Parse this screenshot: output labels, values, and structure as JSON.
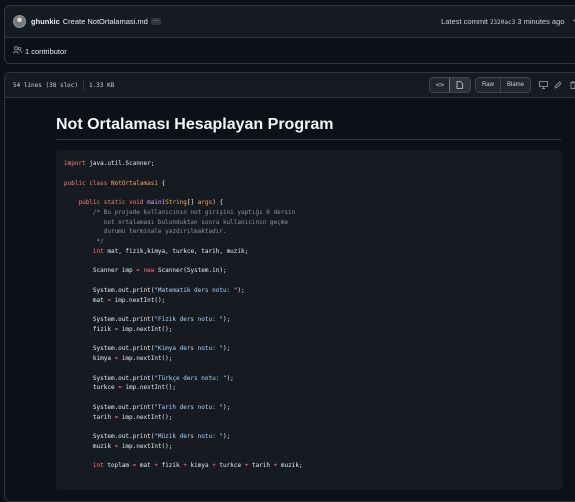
{
  "commit": {
    "author": "ghunkic",
    "message": "Create NotOrtalamasi.md",
    "ellipsis": "…",
    "latest_prefix": "Latest commit",
    "sha": "2320ac3",
    "time_ago": "3 minutes ago",
    "contributors": "1 contributor"
  },
  "file": {
    "lines_info": "54 lines (38 sloc)",
    "size": "1.33 KB",
    "code_view_icon": "<>",
    "preview_icon": "▯",
    "raw_label": "Raw",
    "blame_label": "Blame"
  },
  "markdown": {
    "title": "Not Ortalaması Hesaplayan Program"
  },
  "code": [
    [
      {
        "t": "import",
        "c": "kw"
      },
      {
        "t": " java.util.Scanner;",
        "c": "pl"
      }
    ],
    [],
    [
      {
        "t": "public",
        "c": "kw"
      },
      {
        "t": " ",
        "c": "pl"
      },
      {
        "t": "class",
        "c": "kw"
      },
      {
        "t": " ",
        "c": "pl"
      },
      {
        "t": "NotOrtalamasi",
        "c": "ty"
      },
      {
        "t": " {",
        "c": "pl"
      }
    ],
    [],
    [
      {
        "t": "    ",
        "c": "pl"
      },
      {
        "t": "public",
        "c": "kw"
      },
      {
        "t": " ",
        "c": "pl"
      },
      {
        "t": "static",
        "c": "kw"
      },
      {
        "t": " ",
        "c": "pl"
      },
      {
        "t": "void",
        "c": "kw"
      },
      {
        "t": " ",
        "c": "pl"
      },
      {
        "t": "main",
        "c": "fn"
      },
      {
        "t": "(",
        "c": "pl"
      },
      {
        "t": "String",
        "c": "ty"
      },
      {
        "t": "[] ",
        "c": "pl"
      },
      {
        "t": "args",
        "c": "ty"
      },
      {
        "t": ") {",
        "c": "pl"
      }
    ],
    [
      {
        "t": "        /* Bu projede kullanıcının not girişini yaptığı 6 dersin",
        "c": "cm"
      }
    ],
    [
      {
        "t": "           not ortalaması bulunduktan sonra kullanıcının geçme",
        "c": "cm"
      }
    ],
    [
      {
        "t": "           durumu terminale yazdırılmaktadır.",
        "c": "cm"
      }
    ],
    [
      {
        "t": "         */",
        "c": "cm"
      }
    ],
    [
      {
        "t": "        ",
        "c": "pl"
      },
      {
        "t": "int",
        "c": "kw"
      },
      {
        "t": " mat, fizik,kimya, turkce, tarih, muzik;",
        "c": "pl"
      }
    ],
    [],
    [
      {
        "t": "        Scanner imp ",
        "c": "pl"
      },
      {
        "t": "=",
        "c": "op"
      },
      {
        "t": " ",
        "c": "pl"
      },
      {
        "t": "new",
        "c": "kw"
      },
      {
        "t": " Scanner(System.in);",
        "c": "pl"
      }
    ],
    [],
    [
      {
        "t": "        System.out.print(",
        "c": "pl"
      },
      {
        "t": "\"Matematik ders notu: \"",
        "c": "str"
      },
      {
        "t": ");",
        "c": "pl"
      }
    ],
    [
      {
        "t": "        mat ",
        "c": "pl"
      },
      {
        "t": "=",
        "c": "op"
      },
      {
        "t": " imp.nextInt();",
        "c": "pl"
      }
    ],
    [],
    [
      {
        "t": "        System.out.print(",
        "c": "pl"
      },
      {
        "t": "\"Fizik ders notu: \"",
        "c": "str"
      },
      {
        "t": ");",
        "c": "pl"
      }
    ],
    [
      {
        "t": "        fizik ",
        "c": "pl"
      },
      {
        "t": "=",
        "c": "op"
      },
      {
        "t": " imp.nextInt();",
        "c": "pl"
      }
    ],
    [],
    [
      {
        "t": "        System.out.print(",
        "c": "pl"
      },
      {
        "t": "\"Kimya ders notu: \"",
        "c": "str"
      },
      {
        "t": ");",
        "c": "pl"
      }
    ],
    [
      {
        "t": "        kimya ",
        "c": "pl"
      },
      {
        "t": "=",
        "c": "op"
      },
      {
        "t": " imp.nextInt();",
        "c": "pl"
      }
    ],
    [],
    [
      {
        "t": "        System.out.print(",
        "c": "pl"
      },
      {
        "t": "\"Türkçe ders notu: \"",
        "c": "str"
      },
      {
        "t": ");",
        "c": "pl"
      }
    ],
    [
      {
        "t": "        turkce ",
        "c": "pl"
      },
      {
        "t": "=",
        "c": "op"
      },
      {
        "t": " imp.nextInt();",
        "c": "pl"
      }
    ],
    [],
    [
      {
        "t": "        System.out.print(",
        "c": "pl"
      },
      {
        "t": "\"Tarih ders notu: \"",
        "c": "str"
      },
      {
        "t": ");",
        "c": "pl"
      }
    ],
    [
      {
        "t": "        tarih ",
        "c": "pl"
      },
      {
        "t": "=",
        "c": "op"
      },
      {
        "t": " imp.nextInt();",
        "c": "pl"
      }
    ],
    [],
    [
      {
        "t": "        System.out.print(",
        "c": "pl"
      },
      {
        "t": "\"Müzik ders notu: \"",
        "c": "str"
      },
      {
        "t": ");",
        "c": "pl"
      }
    ],
    [
      {
        "t": "        muzik ",
        "c": "pl"
      },
      {
        "t": "=",
        "c": "op"
      },
      {
        "t": " imp.nextInt();",
        "c": "pl"
      }
    ],
    [],
    [
      {
        "t": "        ",
        "c": "pl"
      },
      {
        "t": "int",
        "c": "kw"
      },
      {
        "t": " toplam ",
        "c": "pl"
      },
      {
        "t": "=",
        "c": "op"
      },
      {
        "t": " mat ",
        "c": "pl"
      },
      {
        "t": "+",
        "c": "op"
      },
      {
        "t": " fizik ",
        "c": "pl"
      },
      {
        "t": "+",
        "c": "op"
      },
      {
        "t": " kimya ",
        "c": "pl"
      },
      {
        "t": "+",
        "c": "op"
      },
      {
        "t": " turkce ",
        "c": "pl"
      },
      {
        "t": "+",
        "c": "op"
      },
      {
        "t": " tarih ",
        "c": "pl"
      },
      {
        "t": "+",
        "c": "op"
      },
      {
        "t": " muzik;",
        "c": "pl"
      }
    ]
  ]
}
